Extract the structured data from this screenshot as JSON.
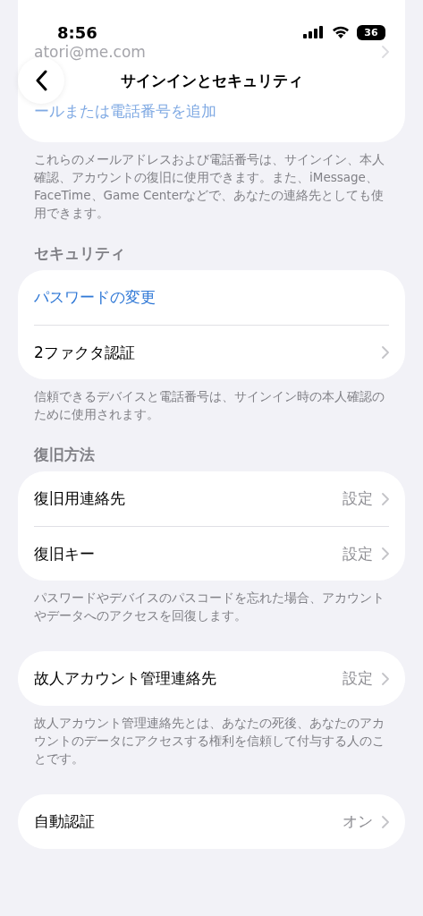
{
  "status_bar": {
    "time": "8:56",
    "battery": "36"
  },
  "nav": {
    "title": "サインインとセキュリティ"
  },
  "contact_group": {
    "rows": [
      {
        "label": "atori@me.com",
        "kind": "value",
        "chevron": true
      },
      {
        "label": "ールまたは電話番号を追加",
        "kind": "action",
        "chevron": false
      }
    ],
    "footer": "これらのメールアドレスおよび電話番号は、サインイン、本人確認、アカウントの復旧に使用できます。また、iMessage、FaceTime、Game Centerなどで、あなたの連絡先としても使用できます。"
  },
  "sections": [
    {
      "header": "セキュリティ",
      "rows": [
        {
          "label": "パスワードの変更",
          "kind": "action",
          "chevron": false
        },
        {
          "label": "2ファクタ認証",
          "kind": "nav",
          "chevron": true
        }
      ],
      "footer": "信頼できるデバイスと電話番号は、サインイン時の本人確認のために使用されます。"
    },
    {
      "header": "復旧方法",
      "rows": [
        {
          "label": "復旧用連絡先",
          "value": "設定",
          "kind": "nav",
          "chevron": true
        },
        {
          "label": "復旧キー",
          "value": "設定",
          "kind": "nav",
          "chevron": true
        }
      ],
      "footer": "パスワードやデバイスのパスコードを忘れた場合、アカウントやデータへのアクセスを回復します。"
    },
    {
      "rows": [
        {
          "label": "故人アカウント管理連絡先",
          "value": "設定",
          "kind": "nav",
          "chevron": true
        }
      ],
      "footer": "故人アカウント管理連絡先とは、あなたの死後、あなたのアカウントのデータにアクセスする権利を信頼して付与する人のことです。"
    },
    {
      "rows": [
        {
          "label": "自動認証",
          "value": "オン",
          "kind": "nav",
          "chevron": true
        }
      ]
    }
  ]
}
